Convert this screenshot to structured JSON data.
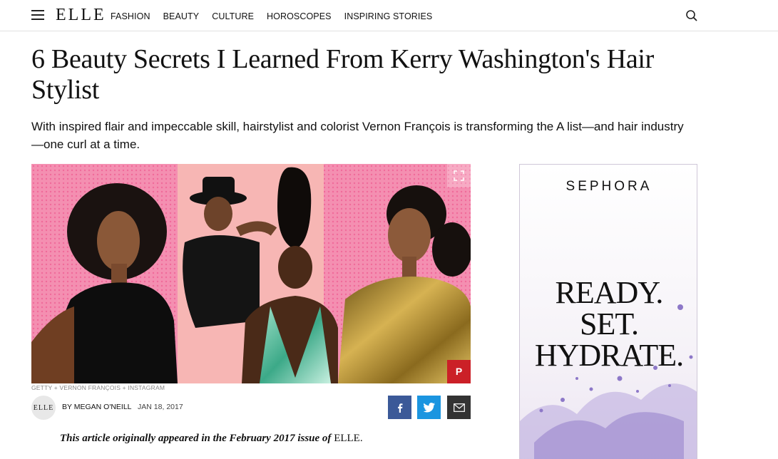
{
  "header": {
    "logo": "ELLE",
    "nav": [
      "FASHION",
      "BEAUTY",
      "CULTURE",
      "HOROSCOPES",
      "INSPIRING STORIES"
    ]
  },
  "article": {
    "title": "6 Beauty Secrets I Learned From Kerry Washington's Hair Stylist",
    "dek": "With inspired flair and impeccable skill, hairstylist and colorist Vernon François is transforming the A list—and hair industry—one curl at a time.",
    "image_credit": "GETTY + VERNON FRANÇOIS + INSTAGRAM",
    "avatar_text": "ELLE",
    "byline": "BY MEGAN O'NEILL",
    "date": "JAN 18, 2017",
    "intro_text": "This article originally appeared in the February 2017 issue of ",
    "intro_pub": "ELLE."
  },
  "ad": {
    "brand": "SEPHORA",
    "lines": [
      "READY.",
      "SET.",
      "HYDRATE."
    ]
  },
  "icons": {
    "menu": "hamburger-icon",
    "search": "search-icon",
    "expand": "expand-icon",
    "pinterest": "pinterest-icon",
    "facebook": "facebook-icon",
    "twitter": "twitter-icon",
    "email": "email-icon"
  },
  "colors": {
    "facebook": "#3b5998",
    "twitter": "#1b95e0",
    "email": "#333333",
    "pinterest": "#cb2027",
    "hero_pink": "#f7a3b8"
  }
}
